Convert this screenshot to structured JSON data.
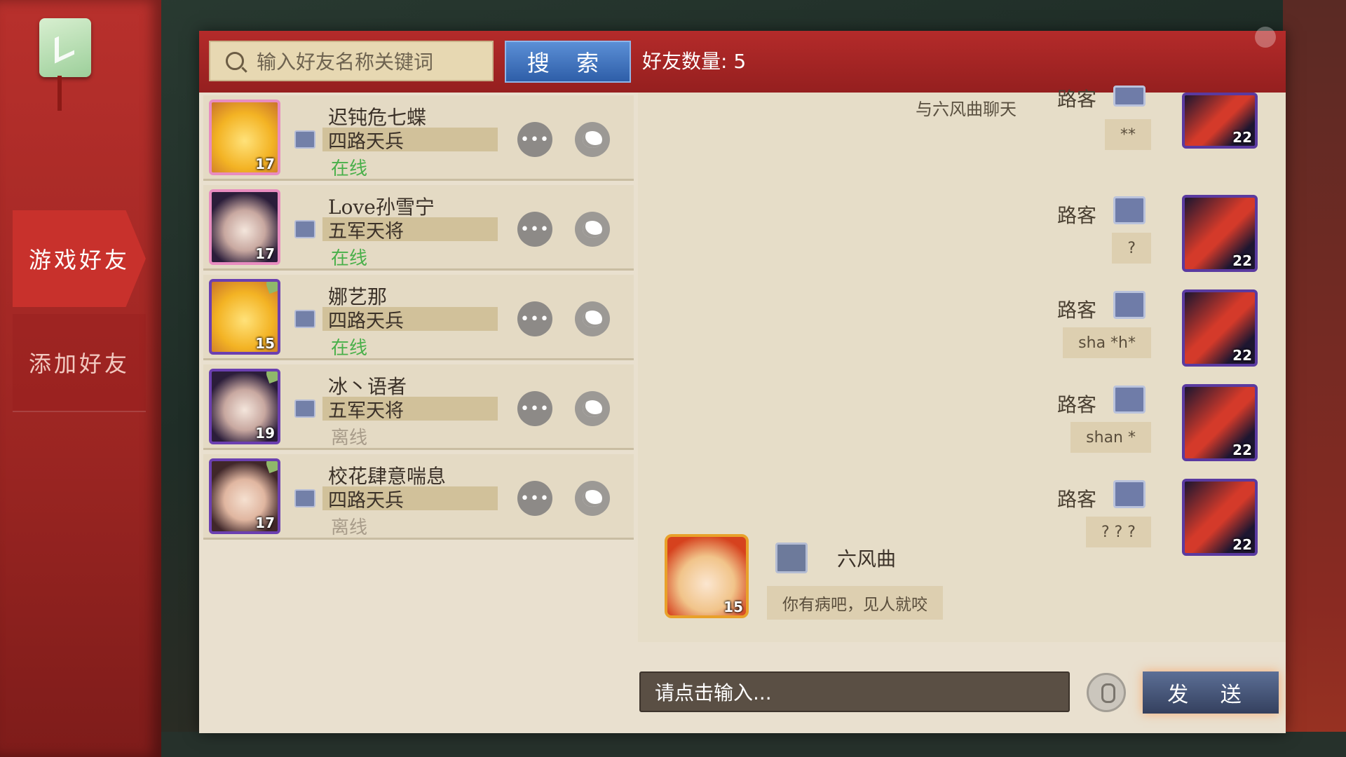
{
  "sidebar": {
    "tabs": [
      {
        "label": "游戏好友",
        "active": true
      },
      {
        "label": "添加好友",
        "active": false
      }
    ]
  },
  "topbar": {
    "search_placeholder": "输入好友名称关键词",
    "search_button": "搜 索",
    "friend_count": "好友数量: 5"
  },
  "friends": [
    {
      "name": "迟钝危七蝶",
      "rank": "四路天兵",
      "status": "在线",
      "level": "17"
    },
    {
      "name": "Love孙雪宁",
      "rank": "五军天将",
      "status": "在线",
      "level": "17"
    },
    {
      "name": "娜艺那",
      "rank": "四路天兵",
      "status": "在线",
      "level": "15"
    },
    {
      "name": "冰丶语者",
      "rank": "五军天将",
      "status": "离线",
      "level": "19"
    },
    {
      "name": "校花肆意喘息",
      "rank": "四路天兵",
      "status": "离线",
      "level": "17"
    }
  ],
  "chat": {
    "title": "与六风曲聊天",
    "messages_right": [
      {
        "name": "路客",
        "text": "**",
        "level": "22"
      },
      {
        "name": "路客",
        "text": "?",
        "level": "22"
      },
      {
        "name": "路客",
        "text": "sha *h*",
        "level": "22"
      },
      {
        "name": "路客",
        "text": "shan *",
        "level": "22"
      },
      {
        "name": "路客",
        "text": "? ? ?",
        "level": "22"
      }
    ],
    "message_left": {
      "name": "六风曲",
      "text": "你有病吧，见人就咬",
      "level": "15"
    },
    "input_placeholder": "请点击输入...",
    "send_button": "发 送"
  }
}
